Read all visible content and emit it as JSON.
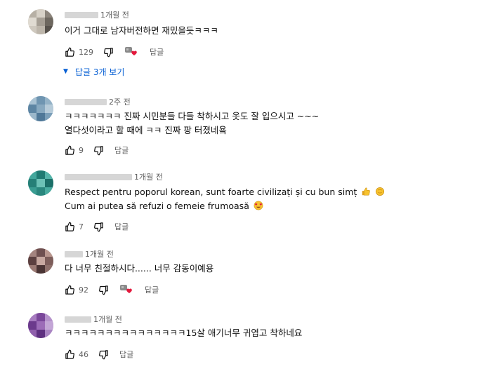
{
  "comments": [
    {
      "time": "1개월 전",
      "lines": [
        "이거 그대로 남자버전하면 재밌을듯ㅋㅋㅋ"
      ],
      "likes": "129",
      "reply_label": "답글",
      "creator_heart": true,
      "replies_toggle": "답글 3개 보기"
    },
    {
      "time": "2주 전",
      "lines": [
        "ㅋㅋㅋㅋㅋㅋㅋ 진짜 시민분들 다들 착하시고 옷도 잘 입으시고 ~~~",
        "열다섯이라고 할 때에 ㅋㅋ 진짜 팡 터졌네욬"
      ],
      "likes": "9",
      "reply_label": "답글",
      "creator_heart": false
    },
    {
      "time": "1개월 전",
      "lines": [
        "Respect pentru poporul korean, sunt foarte civilizați și cu bun simț",
        "Cum ai putea să refuzi o femeie frumoasă"
      ],
      "likes": "7",
      "reply_label": "답글",
      "creator_heart": false
    },
    {
      "time": "1개월 전",
      "lines": [
        "다 너무 친절하시다...... 너무 감동이예용"
      ],
      "likes": "92",
      "reply_label": "답글",
      "creator_heart": true
    },
    {
      "time": "1개월 전",
      "lines": [
        "ㅋㅋㅋㅋㅋㅋㅋㅋㅋㅋㅋㅋㅋㅋㅋ15살 애기너무 귀엽고 착하네요"
      ],
      "likes": "46",
      "reply_label": "답글",
      "creator_heart": false
    }
  ],
  "icons": {
    "like": "thumb-up-icon",
    "dislike": "thumb-down-icon",
    "heart": "creator-heart-icon",
    "toggle": "caret-down-icon",
    "emoji_thumbs": "thumbs-up-emoji",
    "emoji_clap": "clapping-hands-emoji",
    "emoji_smile": "heart-eyes-emoji"
  },
  "colors": {
    "link_blue": "#065fd4",
    "meta_gray": "#606060",
    "heart_red": "#e3183c",
    "emoji_yellow": "#f7c22f"
  }
}
